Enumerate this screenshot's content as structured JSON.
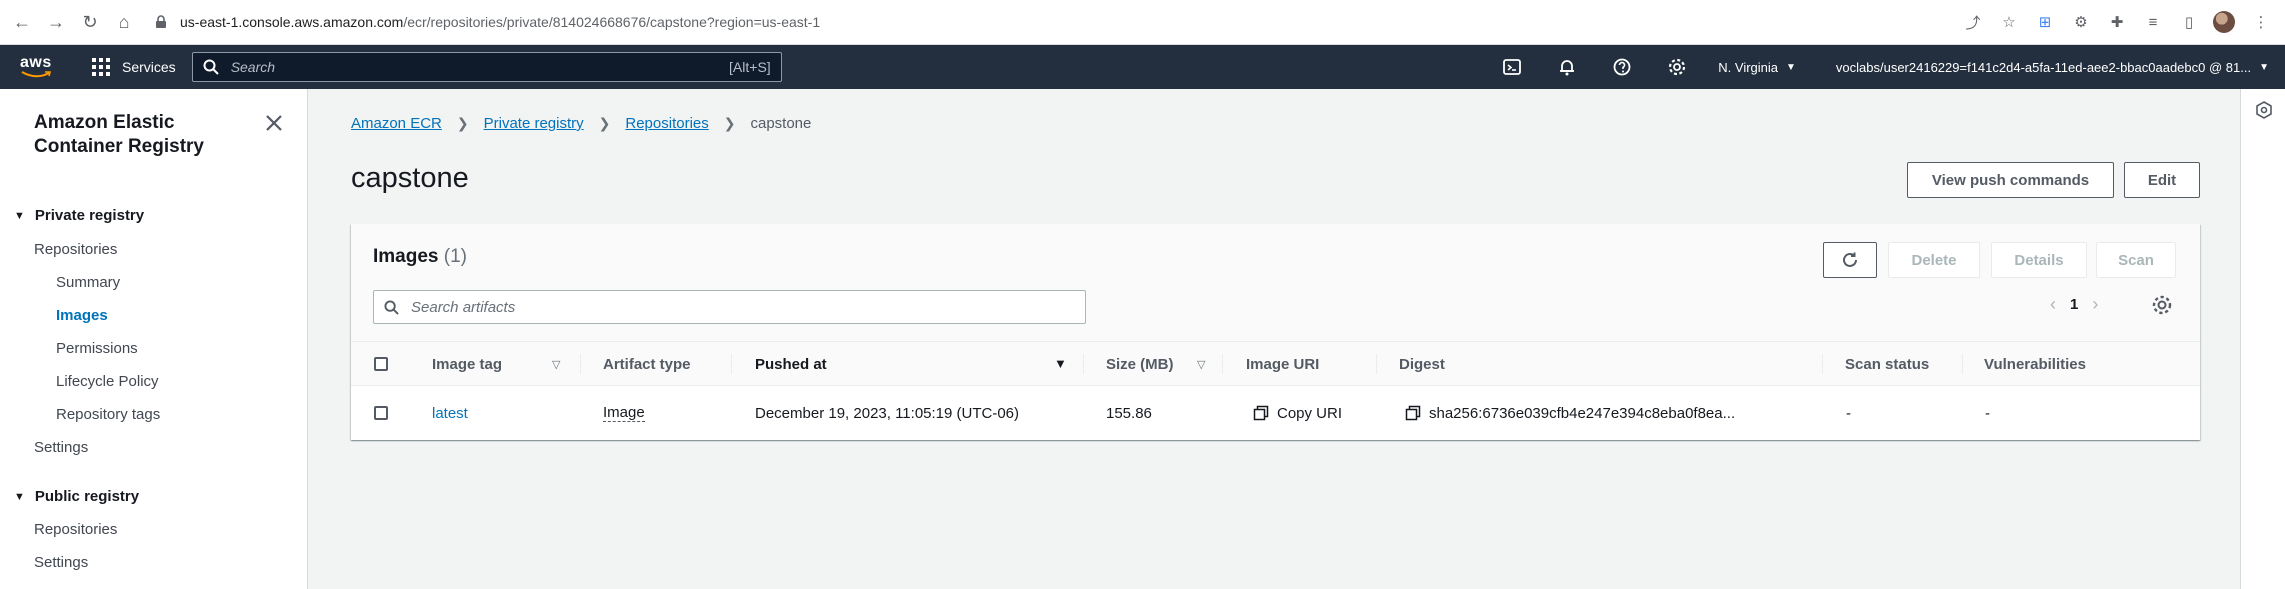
{
  "browser": {
    "url_host": "us-east-1.console.aws.amazon.com",
    "url_path": "/ecr/repositories/private/814024668676/capstone?region=us-east-1"
  },
  "aws_nav": {
    "logo": "aws",
    "services_label": "Services",
    "search_placeholder": "Search",
    "search_shortcut": "[Alt+S]",
    "region": "N. Virginia",
    "account": "voclabs/user2416229=f141c2d4-a5fa-11ed-aee2-bbac0aadebc0 @ 81..."
  },
  "sidebar": {
    "title": "Amazon Elastic Container Registry",
    "private_registry": "Private registry",
    "private_items": {
      "repositories": "Repositories",
      "summary": "Summary",
      "images": "Images",
      "permissions": "Permissions",
      "lifecycle": "Lifecycle Policy",
      "repo_tags": "Repository tags",
      "settings": "Settings"
    },
    "public_registry": "Public registry",
    "public_items": {
      "repositories": "Repositories",
      "settings": "Settings"
    }
  },
  "breadcrumb": {
    "items": [
      "Amazon ECR",
      "Private registry",
      "Repositories"
    ],
    "current": "capstone"
  },
  "page": {
    "title": "capstone",
    "view_push_label": "View push commands",
    "edit_label": "Edit"
  },
  "images_panel": {
    "title": "Images",
    "count": "(1)",
    "delete_label": "Delete",
    "details_label": "Details",
    "scan_label": "Scan",
    "search_placeholder": "Search artifacts",
    "page_number": "1",
    "columns": {
      "tag": "Image tag",
      "artifact": "Artifact type",
      "pushed": "Pushed at",
      "size": "Size (MB)",
      "uri": "Image URI",
      "digest": "Digest",
      "scan": "Scan status",
      "vuln": "Vulnerabilities"
    },
    "rows": [
      {
        "tag": "latest",
        "artifact": "Image",
        "pushed": "December 19, 2023, 11:05:19 (UTC-06)",
        "size": "155.86",
        "uri": "Copy URI",
        "digest": "sha256:6736e039cfb4e247e394c8eba0f8ea...",
        "scan": "-",
        "vuln": "-"
      }
    ]
  },
  "colors": {
    "nav_bg": "#232f3e",
    "link": "#0073bb",
    "page_bg": "#f2f3f3"
  }
}
